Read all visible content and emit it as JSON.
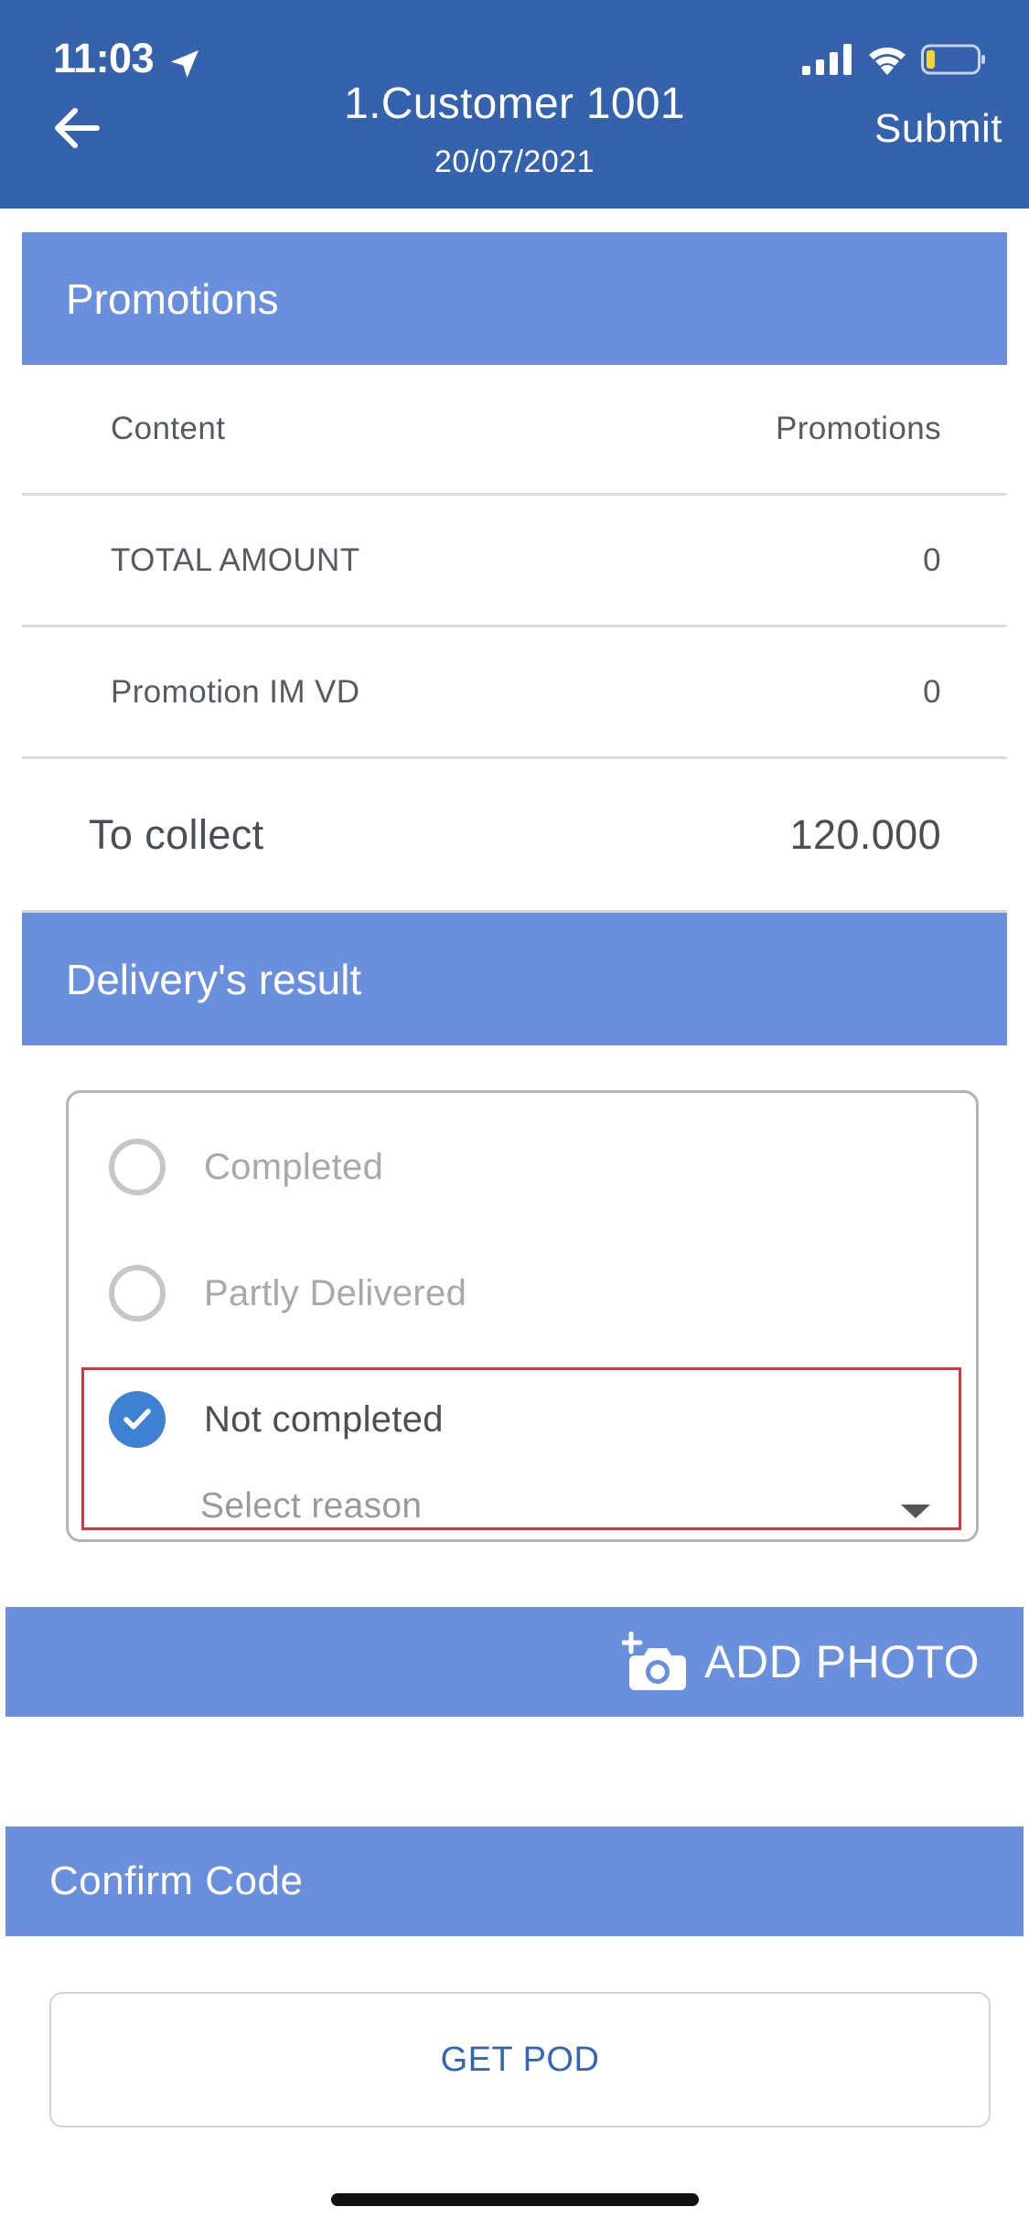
{
  "status_bar": {
    "time": "11:03",
    "icons": [
      "location-arrow-icon",
      "cellular-signal-icon",
      "wifi-icon",
      "battery-low-icon"
    ]
  },
  "header": {
    "title": "1.Customer 1001",
    "date": "20/07/2021",
    "submit_label": "Submit",
    "back_icon": "arrow-left-icon",
    "background_color": "#3462ac"
  },
  "promotions": {
    "section_title": "Promotions",
    "columns": [
      "Content",
      "Promotions"
    ],
    "rows": [
      {
        "label": "TOTAL AMOUNT",
        "value": "0"
      },
      {
        "label": "Promotion IM VD",
        "value": "0"
      }
    ],
    "to_collect_label": "To collect",
    "to_collect_value": "120.000"
  },
  "delivery": {
    "section_title": "Delivery's result",
    "options": [
      {
        "label": "Completed",
        "selected": false
      },
      {
        "label": "Partly Delivered",
        "selected": false
      },
      {
        "label": "Not completed",
        "selected": true
      }
    ],
    "reason_placeholder": "Select reason",
    "highlight_color": "#d9363e",
    "selected_color": "#3e81d3"
  },
  "actions": {
    "add_photo_label": "ADD PHOTO",
    "confirm_code_label": "Confirm Code",
    "get_pod_label": "GET POD",
    "section_color": "#6a8fdd"
  }
}
